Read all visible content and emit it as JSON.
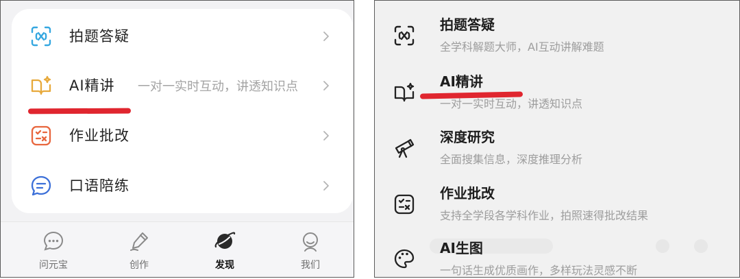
{
  "left": {
    "menu": [
      {
        "label": "拍题答疑",
        "icon": "scan-x-icon"
      },
      {
        "label": "AI精讲",
        "desc": "一对一实时互动，讲透知识点",
        "icon": "ai-book-icon"
      },
      {
        "label": "作业批改",
        "icon": "homework-check-icon"
      },
      {
        "label": "口语陪练",
        "icon": "chat-bubble-icon"
      }
    ],
    "tabs": [
      {
        "label": "问元宝",
        "icon": "chat-dots-icon"
      },
      {
        "label": "创作",
        "icon": "pen-icon"
      },
      {
        "label": "发现",
        "icon": "planet-icon",
        "active": true
      },
      {
        "label": "我们",
        "icon": "smile-face-icon"
      }
    ]
  },
  "right": {
    "menu": [
      {
        "title": "拍题答疑",
        "sub": "全学科解题大师，AI互动讲解难题",
        "icon": "scan-x-icon"
      },
      {
        "title": "AI精讲",
        "sub": "一对一实时互动，讲透知识点",
        "icon": "ai-book-icon"
      },
      {
        "title": "深度研究",
        "sub": "全面搜集信息，深度推理分析",
        "icon": "telescope-icon"
      },
      {
        "title": "作业批改",
        "sub": "支持全学段各学科作业，拍照速得批改结果",
        "icon": "homework-check-icon"
      },
      {
        "title": "AI生图",
        "sub": "一句话生成优质画作，多样玩法灵感不断",
        "icon": "palette-icon"
      }
    ]
  },
  "colors": {
    "accent_underline": "#e0262f",
    "scan_icon": "#35a7e0",
    "book_icon": "#e7a93b",
    "check_icon": "#e8663d",
    "chat_icon": "#3b6fd8"
  }
}
